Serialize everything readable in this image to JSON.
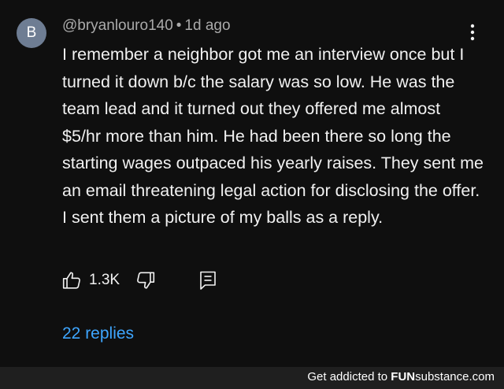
{
  "comment": {
    "avatar_letter": "B",
    "username": "@bryanlouro140",
    "separator": "•",
    "time": "1d ago",
    "text": "I remember a neighbor got me an interview once but I turned it down b/c the salary was so low. He was the team lead and it turned out they offered me almost $5/hr more than him. He had been there so long the starting wages outpaced his yearly raises. They sent me an email threatening legal action for disclosing the offer. I sent them a picture of my balls as a reply.",
    "like_count": "1.3K",
    "replies_label": "22 replies"
  },
  "footer": {
    "prefix": "Get addicted to",
    "brand_part1": "FUN",
    "brand_part2": "substance.com"
  },
  "icons": {
    "menu": "more-vert-icon",
    "like": "thumbs-up-icon",
    "dislike": "thumbs-down-icon",
    "reply": "reply-comment-icon"
  },
  "colors": {
    "background": "#0f0f0f",
    "text": "#f1f1f1",
    "meta": "#aaaaaa",
    "link": "#3ea6ff",
    "avatar": "#6e7d93",
    "footer_bg": "#1f1f1f"
  }
}
